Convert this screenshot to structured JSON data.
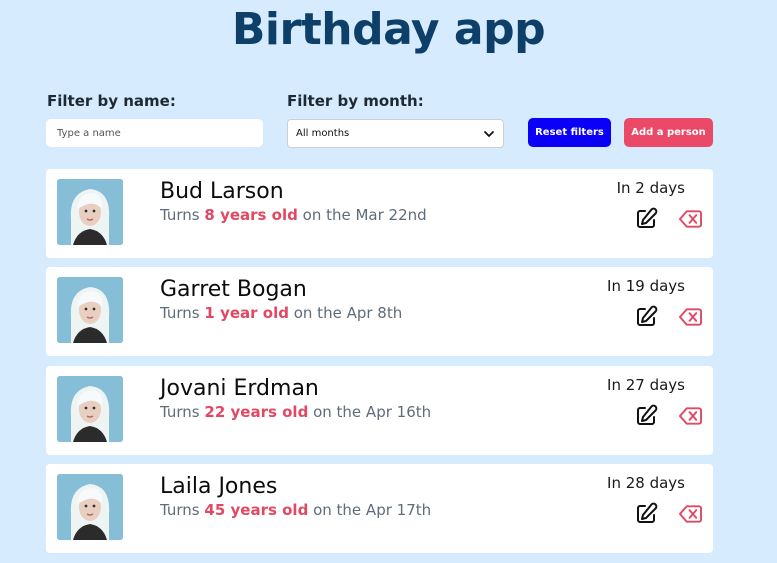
{
  "app": {
    "title": "Birthday app"
  },
  "filters": {
    "name_label": "Filter by name:",
    "name_placeholder": "Type a name",
    "name_value": "",
    "month_label": "Filter by month:",
    "month_selected": "All months",
    "reset_label": "Reset filters",
    "add_label": "Add a person"
  },
  "colors": {
    "background": "#d6ebfd",
    "title": "#0d3f68",
    "reset_button": "#0a00f7",
    "add_button": "#ea4a67",
    "age_highlight": "#e24862"
  },
  "icons": {
    "edit": "edit-icon",
    "delete": "backspace-delete-icon",
    "dropdown": "chevron-down-icon"
  },
  "people": [
    {
      "name": "Bud Larson",
      "turns_prefix": "Turns",
      "age_text": "8 years old",
      "date_text": "on the Mar 22nd",
      "days_left": "In 2 days"
    },
    {
      "name": "Garret Bogan",
      "turns_prefix": "Turns",
      "age_text": "1 year old",
      "date_text": "on the Apr 8th",
      "days_left": "In 19 days"
    },
    {
      "name": "Jovani Erdman",
      "turns_prefix": "Turns",
      "age_text": "22 years old",
      "date_text": "on the Apr 16th",
      "days_left": "In 27 days"
    },
    {
      "name": "Laila Jones",
      "turns_prefix": "Turns",
      "age_text": "45 years old",
      "date_text": "on the Apr 17th",
      "days_left": "In 28 days"
    }
  ]
}
